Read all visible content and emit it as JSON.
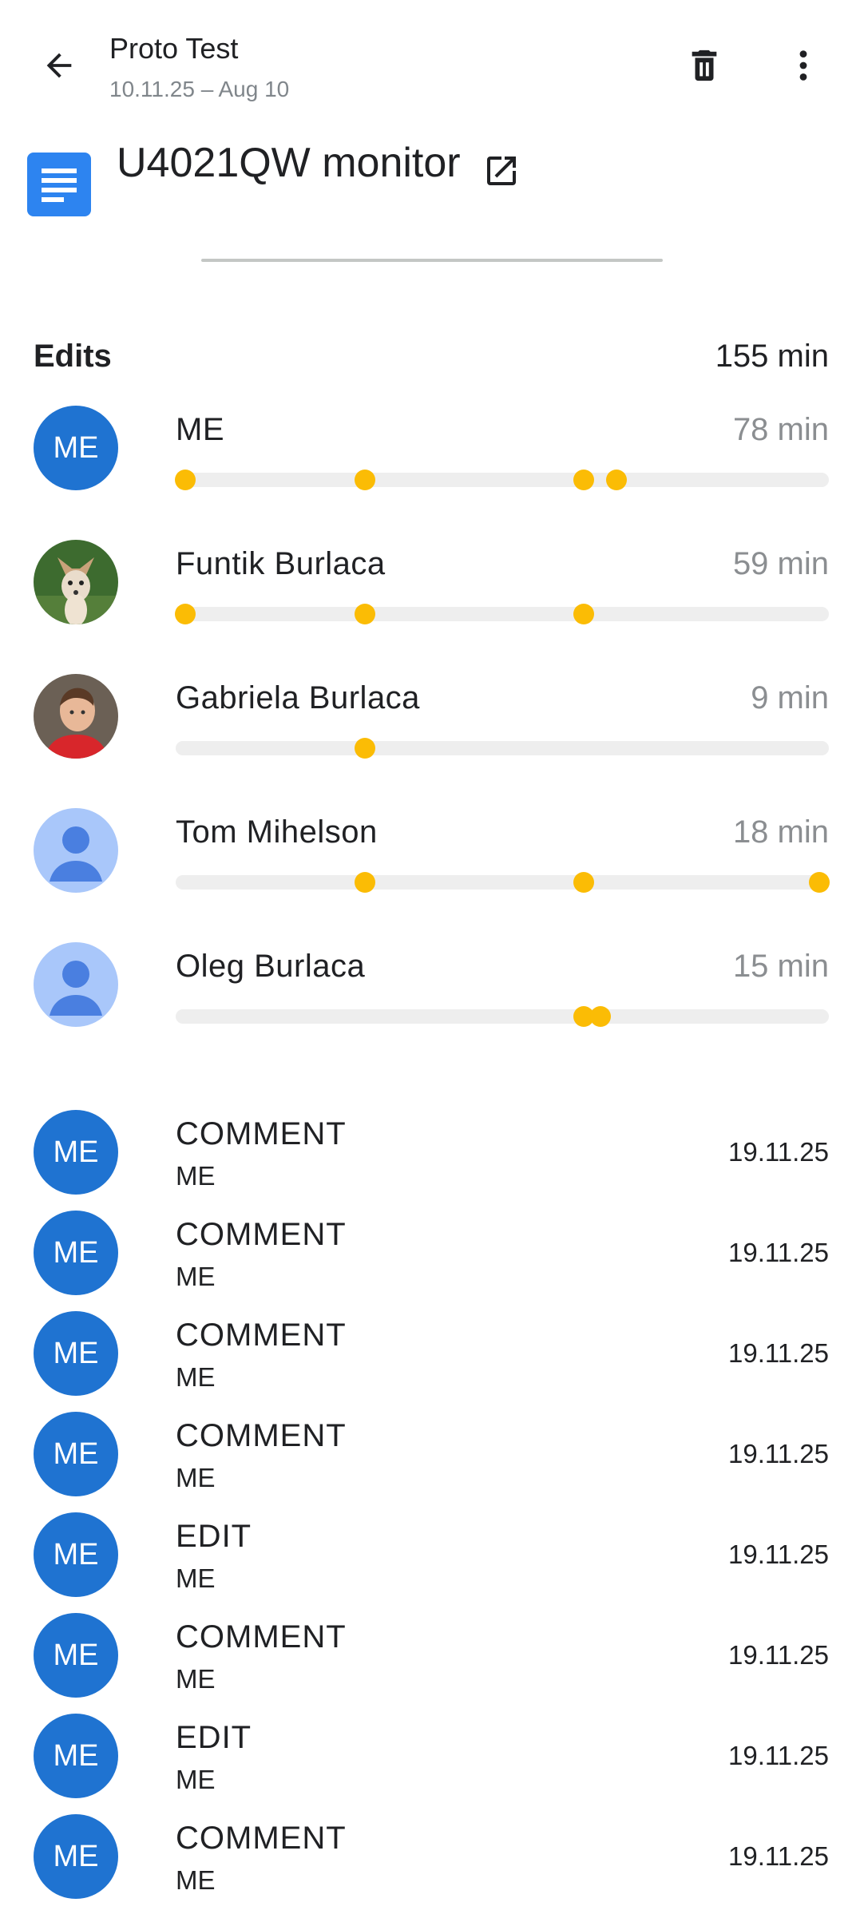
{
  "header": {
    "title": "Proto Test",
    "subtitle": "10.11.25 – Aug 10",
    "back_icon": "arrow-back-icon",
    "delete_icon": "trash-icon",
    "more_icon": "more-vert-icon"
  },
  "document": {
    "title": "U4021QW monitor",
    "icon": "docs-icon",
    "open_icon": "open-in-new-icon",
    "icon_color": "#2d84f0"
  },
  "edits": {
    "label": "Edits",
    "total": "155 min",
    "dot_color": "#fbbc05",
    "users": [
      {
        "name": "ME",
        "minutes": "78 min",
        "avatar": "ME",
        "avatar_type": "initials",
        "dots": [
          0.015,
          0.29,
          0.625,
          0.675
        ]
      },
      {
        "name": "Funtik Burlaca",
        "minutes": "59 min",
        "avatar": "dog-photo",
        "avatar_type": "photo",
        "dots": [
          0.015,
          0.29,
          0.625
        ]
      },
      {
        "name": "Gabriela Burlaca",
        "minutes": "9 min",
        "avatar": "child-photo",
        "avatar_type": "photo",
        "dots": [
          0.29
        ]
      },
      {
        "name": "Tom Mihelson",
        "minutes": "18 min",
        "avatar": "person-icon",
        "avatar_type": "generic",
        "dots": [
          0.29,
          0.625,
          0.985
        ]
      },
      {
        "name": "Oleg Burlaca",
        "minutes": "15 min",
        "avatar": "person-icon",
        "avatar_type": "generic",
        "dots": [
          0.625,
          0.65
        ]
      }
    ]
  },
  "activity": [
    {
      "avatar": "ME",
      "type": "COMMENT",
      "user": "ME",
      "date": "19.11.25"
    },
    {
      "avatar": "ME",
      "type": "COMMENT",
      "user": "ME",
      "date": "19.11.25"
    },
    {
      "avatar": "ME",
      "type": "COMMENT",
      "user": "ME",
      "date": "19.11.25"
    },
    {
      "avatar": "ME",
      "type": "COMMENT",
      "user": "ME",
      "date": "19.11.25"
    },
    {
      "avatar": "ME",
      "type": "EDIT",
      "user": "ME",
      "date": "19.11.25"
    },
    {
      "avatar": "ME",
      "type": "COMMENT",
      "user": "ME",
      "date": "19.11.25"
    },
    {
      "avatar": "ME",
      "type": "EDIT",
      "user": "ME",
      "date": "19.11.25"
    },
    {
      "avatar": "ME",
      "type": "COMMENT",
      "user": "ME",
      "date": "19.11.25"
    }
  ]
}
